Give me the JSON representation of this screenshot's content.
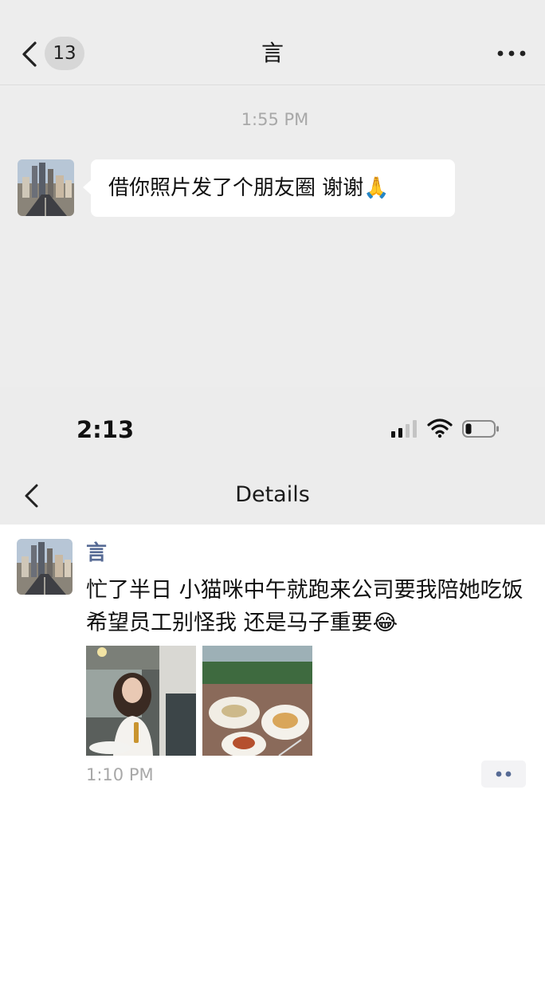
{
  "chat": {
    "unread_count": "13",
    "title": "言",
    "timestamp": "1:55 PM",
    "message": "借你照片发了个朋友圈 谢谢🙏"
  },
  "status_bar": {
    "time": "2:13"
  },
  "details": {
    "title": "Details",
    "post": {
      "author": "言",
      "text": "忙了半日 小猫咪中午就跑来公司要我陪她吃饭 希望员工别怪我 还是马子重要😂",
      "time": "1:10 PM"
    }
  },
  "colors": {
    "chat_background": "#ededed",
    "author_link": "#576b95",
    "timestamp_gray": "#a8a8a8"
  },
  "icons": [
    "back-chevron-icon",
    "more-dots-icon",
    "signal-icon",
    "wifi-icon",
    "battery-icon",
    "comment-dots-icon"
  ]
}
